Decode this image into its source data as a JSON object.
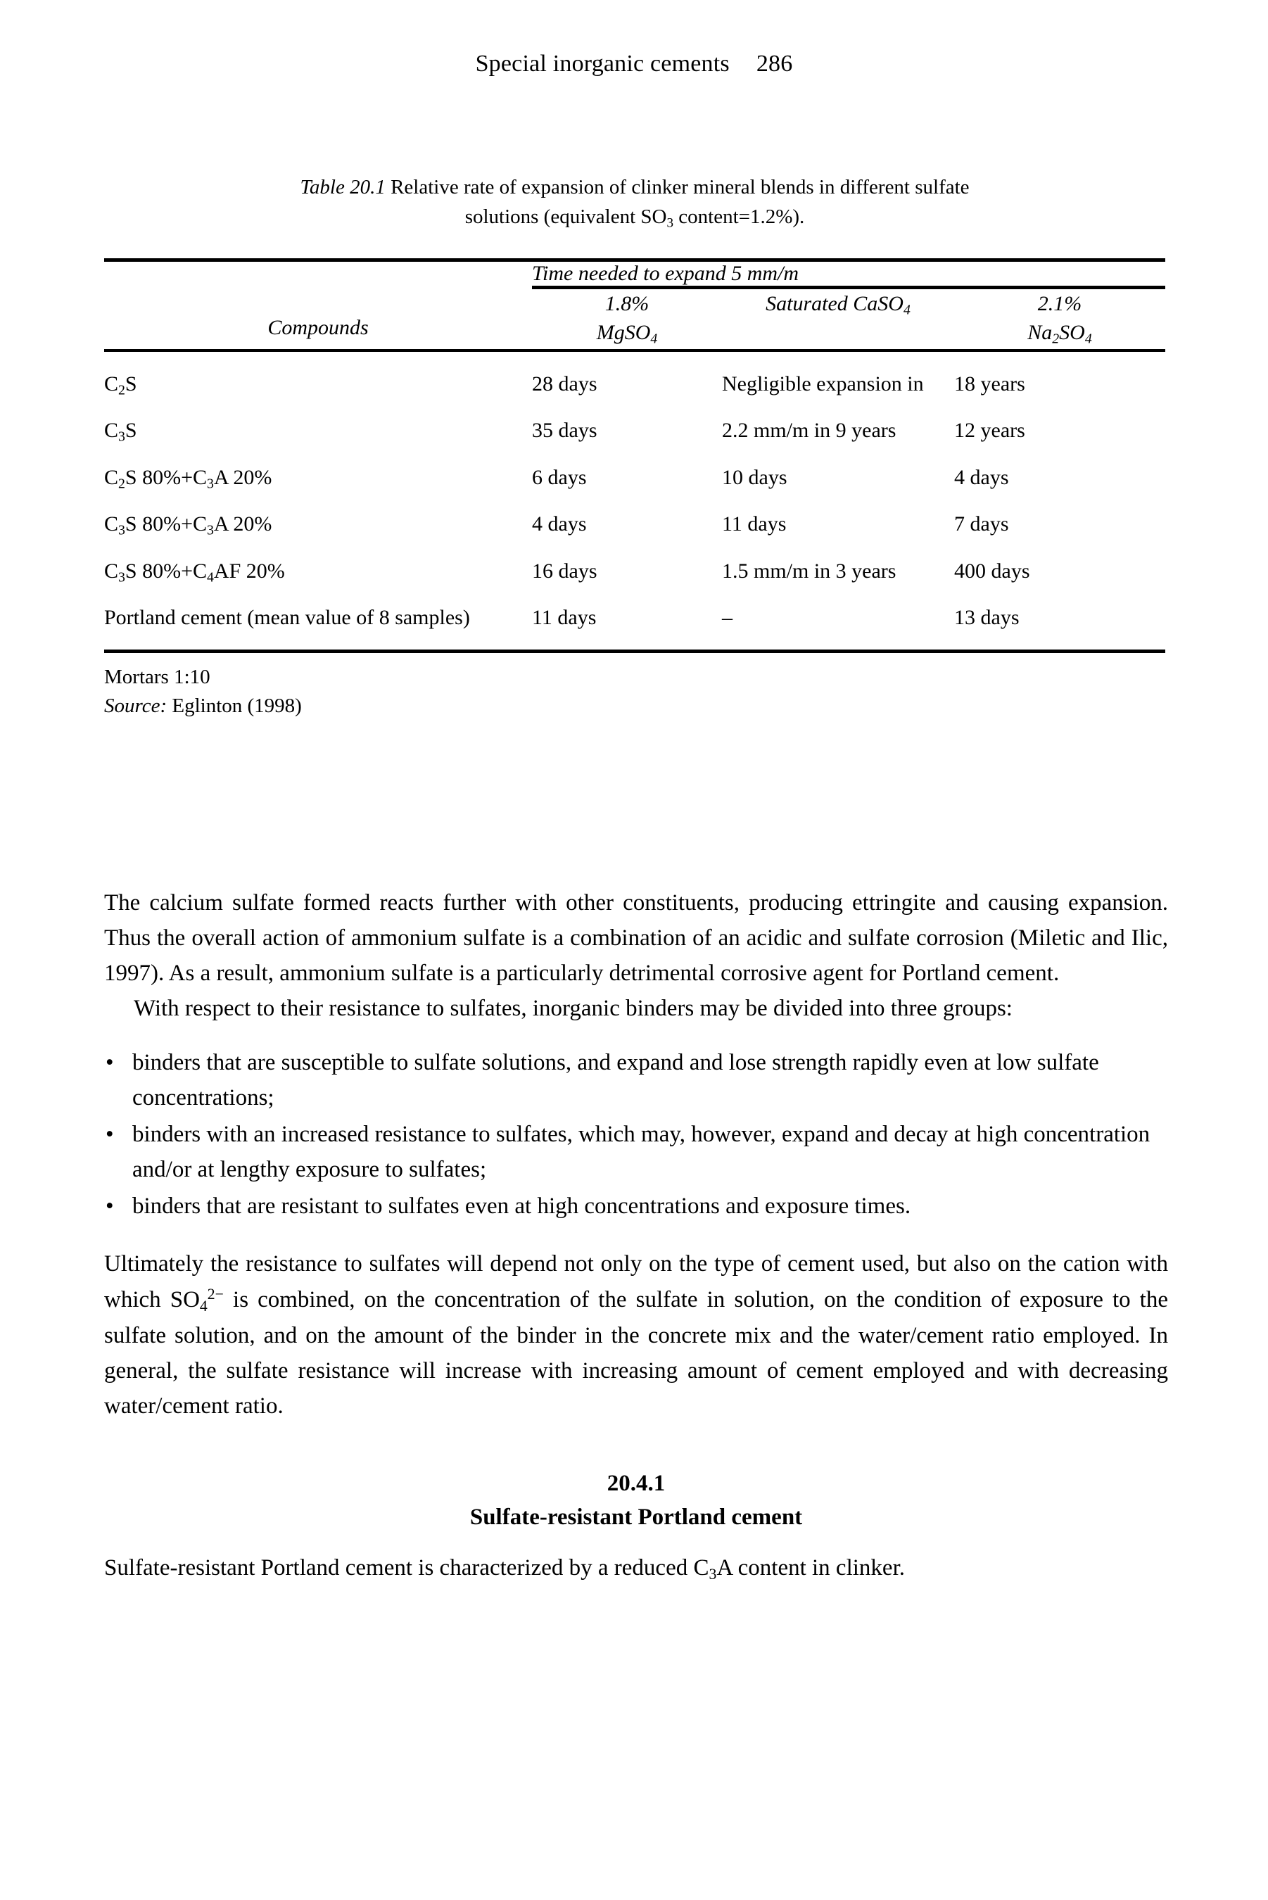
{
  "running_head": {
    "title": "Special inorganic cements",
    "page_number": "286"
  },
  "table": {
    "caption_label": "Table 20.1",
    "caption_text_1": " Relative rate of expansion of clinker mineral blends in different sulfate",
    "caption_line_2_a": "solutions (equivalent SO",
    "caption_line_2_sub": "3",
    "caption_line_2_b": " content=1.2%).",
    "group_header": "Time needed to expand 5 mm/m",
    "columns": {
      "compounds": "Compounds",
      "mgso4_pct": "1.8%",
      "mgso4_formula_a": "MgSO",
      "mgso4_formula_sub": "4",
      "caso4_a": "Saturated CaSO",
      "caso4_sub": "4",
      "na2so4_pct": "2.1%",
      "na2so4_a": "Na",
      "na2so4_sub1": "2",
      "na2so4_b": "SO",
      "na2so4_sub2": "4"
    },
    "rows": [
      {
        "compound_parts": [
          "C",
          "2",
          "S"
        ],
        "compound_plain": "C2S",
        "mgso4": "28 days",
        "caso4": "Negligible expansion in",
        "na2so4": "18 years"
      },
      {
        "compound_parts": [
          "C",
          "3",
          "S"
        ],
        "compound_plain": "C3S",
        "mgso4": "35 days",
        "caso4": "2.2 mm/m in 9 years",
        "na2so4": "12 years"
      },
      {
        "compound_plain": "C2S 80%+C3A 20%",
        "mgso4": "6 days",
        "caso4": "10 days",
        "na2so4": "4 days"
      },
      {
        "compound_plain": "C3S 80%+C3A 20%",
        "mgso4": "4 days",
        "caso4": "11 days",
        "na2so4": "7 days"
      },
      {
        "compound_plain": "C3S 80%+C4AF 20%",
        "mgso4": "16 days",
        "caso4": "1.5 mm/m in 3 years",
        "na2so4": "400 days"
      },
      {
        "compound_plain": "Portland cement (mean value of 8 samples)",
        "mgso4": "11 days",
        "caso4": "–",
        "na2so4": "13 days"
      }
    ],
    "note_mortars": "Mortars 1:10",
    "source_label": "Source:",
    "source_text": " Eglinton (1998)"
  },
  "body": {
    "paragraph_1": "The calcium sulfate formed reacts further with other constituents, producing ettringite and causing expansion. Thus the overall action of ammonium sulfate is a combination of an acidic and sulfate corrosion (Miletic and Ilic, 1997). As a result, ammonium sulfate is a particularly detrimental corrosive agent for Portland cement.",
    "paragraph_2": "With respect to their resistance to sulfates, inorganic binders may be divided into three groups:",
    "bullet_marker": "•",
    "bullets": [
      "binders that are susceptible to sulfate solutions, and expand and lose strength rapidly even at low sulfate concentrations;",
      "binders with an increased resistance to sulfates, which may, however, expand and decay at high concentration and/or at lengthy exposure to sulfates;",
      "binders that are resistant to sulfates even at high concentrations and exposure times."
    ],
    "paragraph_3_a": "Ultimately the resistance to sulfates will depend not only on the type of cement used, but also on the cation with which SO",
    "paragraph_3_sub": "4",
    "paragraph_3_sup": "2−",
    "paragraph_3_b": " is combined, on the concentration of the sulfate in solution, on the condition of exposure to the sulfate solution, and on the amount of the binder in the concrete mix and the water/cement ratio employed. In general, the sulfate resistance will increase with increasing amount of cement employed and with decreasing water/cement ratio.",
    "section_number": "20.4.1",
    "section_title": "Sulfate-resistant Portland cement",
    "paragraph_4_a": "Sulfate-resistant Portland cement is characterized by a reduced C",
    "paragraph_4_sub": "3",
    "paragraph_4_b": "A content in clinker."
  }
}
